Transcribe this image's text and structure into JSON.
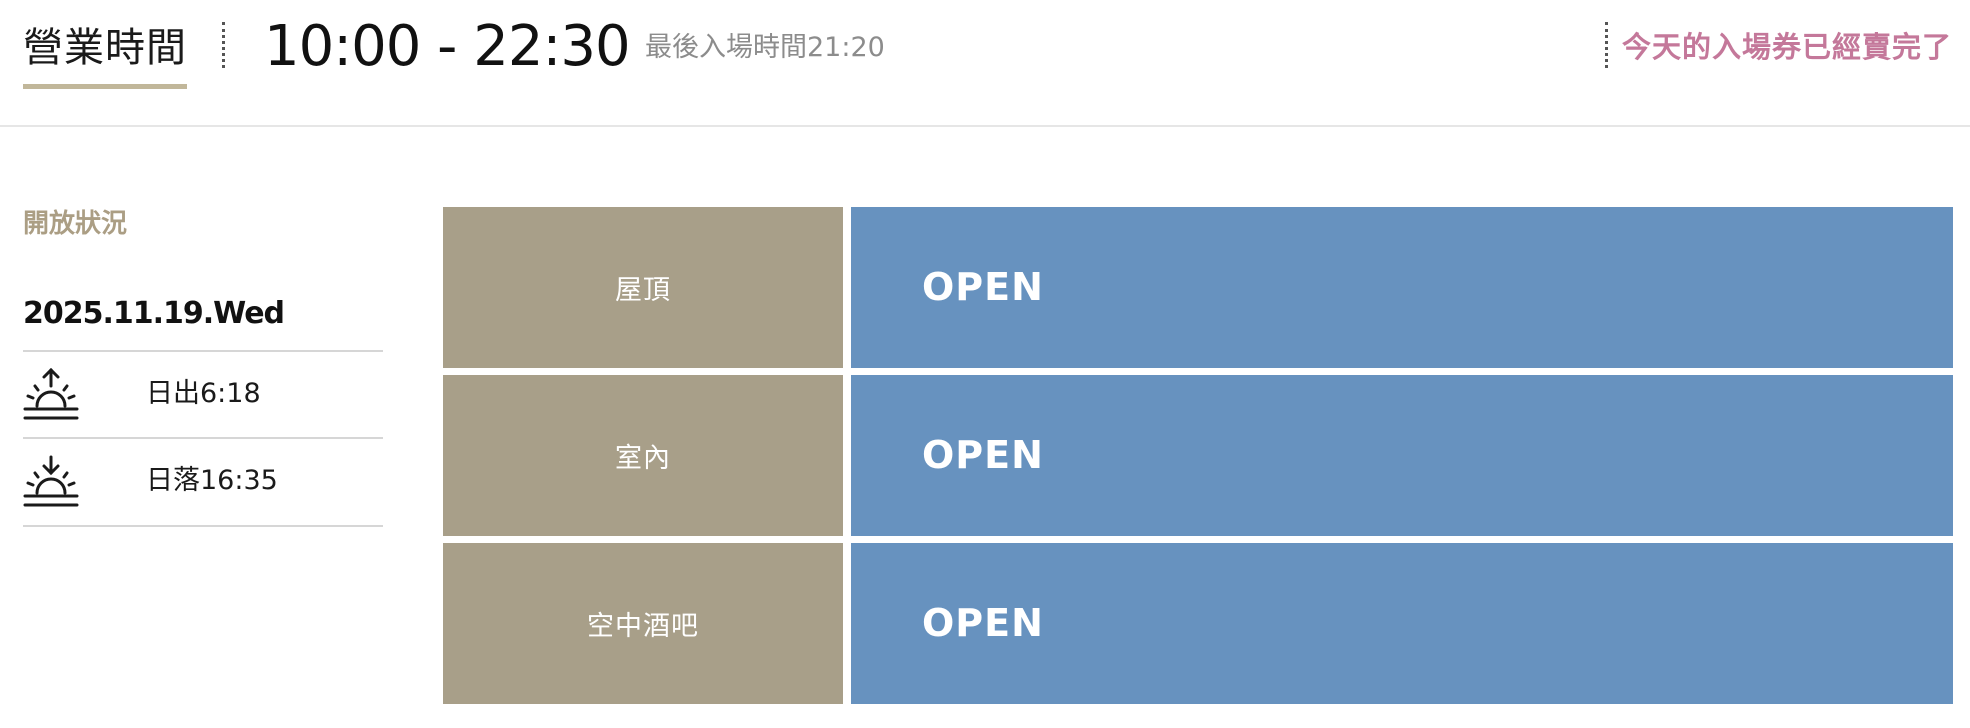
{
  "header": {
    "hours_label": "營業時間",
    "hours_value": "10:00 - 22:30",
    "last_entry": "最後入場時間21:20",
    "sold_out_notice": "今天的入場券已經賣完了"
  },
  "status": {
    "heading": "開放狀況",
    "date": "2025.11.19.Wed",
    "sunrise": {
      "icon": "sunrise-icon",
      "text": "日出6:18"
    },
    "sunset": {
      "icon": "sunset-icon",
      "text": "日落16:35"
    }
  },
  "areas": [
    {
      "name": "屋頂",
      "state": "OPEN"
    },
    {
      "name": "室內",
      "state": "OPEN"
    },
    {
      "name": "空中酒吧",
      "state": "OPEN"
    }
  ],
  "colors": {
    "accent_gold": "#c1b79a",
    "area_bg": "#a89f89",
    "open_bg": "#6792bf",
    "sold_out_pink": "#c4789a"
  }
}
